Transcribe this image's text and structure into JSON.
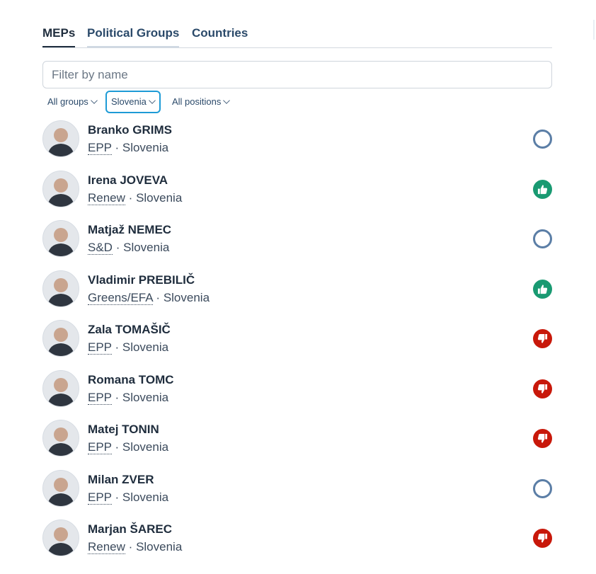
{
  "tabs": [
    {
      "label": "MEPs",
      "active": true
    },
    {
      "label": "Political Groups",
      "active": false
    },
    {
      "label": "Countries",
      "active": false
    }
  ],
  "search": {
    "placeholder": "Filter by name",
    "value": ""
  },
  "filters": {
    "group": "All groups",
    "country": "Slovenia",
    "position": "All positions"
  },
  "colors": {
    "for": "#199a72",
    "against": "#c8180a",
    "did_not_vote": "#5b7ea6",
    "accent": "#1e9bd6"
  },
  "meps": [
    {
      "name": "Branko GRIMS",
      "group": "EPP",
      "separator": "·",
      "country": "Slovenia",
      "vote": "did-not-vote",
      "vote_icon": "empty-circle-icon"
    },
    {
      "name": "Irena JOVEVA",
      "group": "Renew",
      "separator": "·",
      "country": "Slovenia",
      "vote": "for",
      "vote_icon": "thumbs-up-icon"
    },
    {
      "name": "Matjaž NEMEC",
      "group": "S&D",
      "separator": "·",
      "country": "Slovenia",
      "vote": "did-not-vote",
      "vote_icon": "empty-circle-icon"
    },
    {
      "name": "Vladimir PREBILIČ",
      "group": "Greens/EFA",
      "separator": "·",
      "country": "Slovenia",
      "vote": "for",
      "vote_icon": "thumbs-up-icon"
    },
    {
      "name": "Zala TOMAŠIČ",
      "group": "EPP",
      "separator": "·",
      "country": "Slovenia",
      "vote": "against",
      "vote_icon": "thumbs-down-icon"
    },
    {
      "name": "Romana TOMC",
      "group": "EPP",
      "separator": "·",
      "country": "Slovenia",
      "vote": "against",
      "vote_icon": "thumbs-down-icon"
    },
    {
      "name": "Matej TONIN",
      "group": "EPP",
      "separator": "·",
      "country": "Slovenia",
      "vote": "against",
      "vote_icon": "thumbs-down-icon"
    },
    {
      "name": "Milan ZVER",
      "group": "EPP",
      "separator": "·",
      "country": "Slovenia",
      "vote": "did-not-vote",
      "vote_icon": "empty-circle-icon"
    },
    {
      "name": "Marjan ŠAREC",
      "group": "Renew",
      "separator": "·",
      "country": "Slovenia",
      "vote": "against",
      "vote_icon": "thumbs-down-icon"
    }
  ]
}
